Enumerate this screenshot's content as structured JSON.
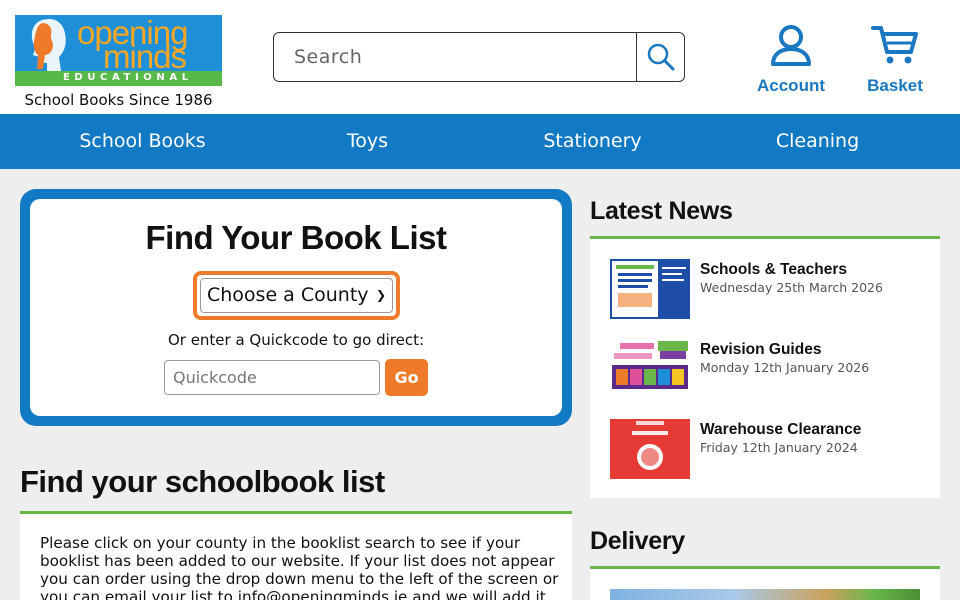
{
  "header": {
    "logo": {
      "line1": "opening",
      "line2": "minds",
      "line3": "EDUCATIONAL"
    },
    "tagline": "School Books Since 1986",
    "search": {
      "placeholder": "Search"
    },
    "account_label": "Account",
    "basket_label": "Basket"
  },
  "nav": {
    "items": [
      {
        "label": "School Books"
      },
      {
        "label": "Toys"
      },
      {
        "label": "Stationery"
      },
      {
        "label": "Cleaning"
      }
    ]
  },
  "find_box": {
    "title": "Find Your Book List",
    "county_select": "Choose a County",
    "quickcode_label": "Or enter a Quickcode to go direct:",
    "quickcode_placeholder": "Quickcode",
    "go_label": "Go"
  },
  "schoolbook": {
    "heading": "Find your schoolbook list",
    "body": "Please click on your county in the booklist search to see if your booklist has been added to our website. If your list does not appear you can order using the drop down menu to the left of the screen or you can email your list to info@openingminds.ie and we will add it to"
  },
  "news": {
    "heading": "Latest News",
    "items": [
      {
        "title": "Schools & Teachers",
        "date": "Wednesday 25th March 2026"
      },
      {
        "title": "Revision Guides",
        "date": "Monday 12th January 2026"
      },
      {
        "title": "Warehouse Clearance",
        "date": "Friday 12th January 2024"
      }
    ]
  },
  "delivery": {
    "heading": "Delivery"
  },
  "colors": {
    "brand_blue": "#1279c4",
    "accent_orange": "#ef7b2a",
    "accent_green": "#6ab64a"
  }
}
